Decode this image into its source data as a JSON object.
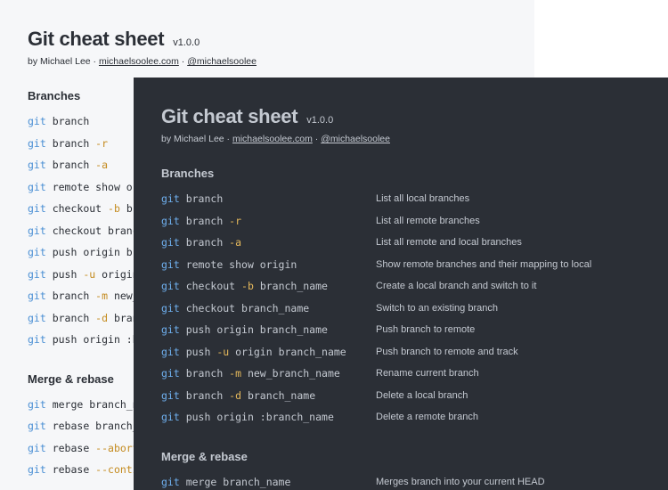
{
  "title": "Git cheat sheet",
  "version": "v1.0.0",
  "byline": {
    "prefix": "by Michael Lee · ",
    "site": "michaelsoolee.com",
    "sep": " · ",
    "handle": "@michaelsoolee"
  },
  "sections": [
    {
      "title": "Branches",
      "commands": [
        {
          "parts": [
            {
              "t": "git",
              "k": "kw"
            },
            {
              "t": " branch",
              "k": "arg"
            }
          ],
          "desc": "List all local branches"
        },
        {
          "parts": [
            {
              "t": "git",
              "k": "kw"
            },
            {
              "t": " branch ",
              "k": "arg"
            },
            {
              "t": "-r",
              "k": "flag"
            }
          ],
          "desc": "List all remote branches"
        },
        {
          "parts": [
            {
              "t": "git",
              "k": "kw"
            },
            {
              "t": " branch ",
              "k": "arg"
            },
            {
              "t": "-a",
              "k": "flag"
            }
          ],
          "desc": "List all remote and local branches"
        },
        {
          "parts": [
            {
              "t": "git",
              "k": "kw"
            },
            {
              "t": " remote show origin",
              "k": "arg"
            }
          ],
          "desc": "Show remote branches and their mapping to local"
        },
        {
          "parts": [
            {
              "t": "git",
              "k": "kw"
            },
            {
              "t": " checkout ",
              "k": "arg"
            },
            {
              "t": "-b",
              "k": "flag"
            },
            {
              "t": " branch_name",
              "k": "arg"
            }
          ],
          "desc": "Create a local branch and switch to it"
        },
        {
          "parts": [
            {
              "t": "git",
              "k": "kw"
            },
            {
              "t": " checkout branch_name",
              "k": "arg"
            }
          ],
          "desc": "Switch to an existing branch"
        },
        {
          "parts": [
            {
              "t": "git",
              "k": "kw"
            },
            {
              "t": " push origin branch_name",
              "k": "arg"
            }
          ],
          "desc": "Push branch to remote"
        },
        {
          "parts": [
            {
              "t": "git",
              "k": "kw"
            },
            {
              "t": " push ",
              "k": "arg"
            },
            {
              "t": "-u",
              "k": "flag"
            },
            {
              "t": " origin branch_name",
              "k": "arg"
            }
          ],
          "desc": "Push branch to remote and track"
        },
        {
          "parts": [
            {
              "t": "git",
              "k": "kw"
            },
            {
              "t": " branch ",
              "k": "arg"
            },
            {
              "t": "-m",
              "k": "flag"
            },
            {
              "t": " new_branch_name",
              "k": "arg"
            }
          ],
          "desc": "Rename current branch"
        },
        {
          "parts": [
            {
              "t": "git",
              "k": "kw"
            },
            {
              "t": " branch ",
              "k": "arg"
            },
            {
              "t": "-d",
              "k": "flag"
            },
            {
              "t": " branch_name",
              "k": "arg"
            }
          ],
          "desc": "Delete a local branch"
        },
        {
          "parts": [
            {
              "t": "git",
              "k": "kw"
            },
            {
              "t": " push origin :branch_name",
              "k": "arg"
            }
          ],
          "desc": "Delete a remote branch"
        }
      ]
    },
    {
      "title": "Merge & rebase",
      "commands": [
        {
          "parts": [
            {
              "t": "git",
              "k": "kw"
            },
            {
              "t": " merge branch_name",
              "k": "arg"
            }
          ],
          "desc": "Merges branch into your current HEAD"
        },
        {
          "parts": [
            {
              "t": "git",
              "k": "kw"
            },
            {
              "t": " rebase branch_name",
              "k": "arg"
            }
          ],
          "desc": ""
        },
        {
          "parts": [
            {
              "t": "git",
              "k": "kw"
            },
            {
              "t": " rebase ",
              "k": "arg"
            },
            {
              "t": "--abort",
              "k": "flag"
            }
          ],
          "desc": ""
        },
        {
          "parts": [
            {
              "t": "git",
              "k": "kw"
            },
            {
              "t": " rebase ",
              "k": "arg"
            },
            {
              "t": "--continue",
              "k": "flag"
            }
          ],
          "desc": ""
        }
      ]
    }
  ]
}
